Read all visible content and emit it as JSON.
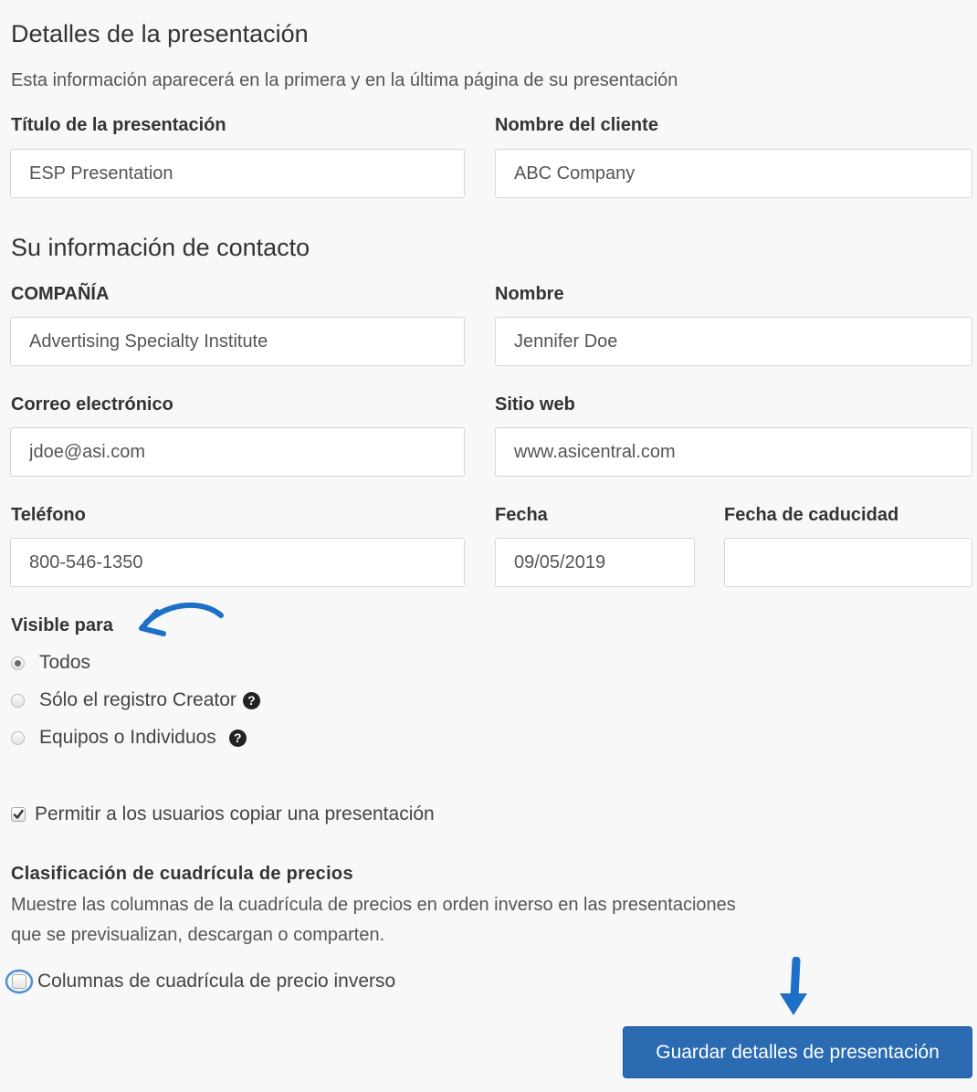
{
  "presentation": {
    "heading": "Detalles de la presentación",
    "description": "Esta información aparecerá en la primera y en la última página de su presentación",
    "title_label": "Título de la presentación",
    "title_value": "ESP Presentation",
    "client_label": "Nombre del cliente",
    "client_value": "ABC Company"
  },
  "contact": {
    "heading": "Su información de contacto",
    "company_label": "COMPAÑÍA",
    "company_value": "Advertising Specialty Institute",
    "name_label": "Nombre",
    "name_value": "Jennifer Doe",
    "email_label": "Correo electrónico",
    "email_value": "jdoe@asi.com",
    "website_label": "Sitio web",
    "website_value": "www.asicentral.com",
    "phone_label": "Teléfono",
    "phone_value": "800-546-1350",
    "date_label": "Fecha",
    "date_value": "09/05/2019",
    "expiry_label": "Fecha de caducidad",
    "expiry_value": ""
  },
  "visibility": {
    "label": "Visible para",
    "options": [
      {
        "label": "Todos",
        "selected": true
      },
      {
        "label": "Sólo el registro Creator",
        "selected": false
      },
      {
        "label": "Equipos o Individuos",
        "selected": false
      }
    ]
  },
  "copy_option": {
    "label": "Permitir a los usuarios copiar una presentación",
    "checked": true
  },
  "price_grid": {
    "heading": "Clasificación de cuadrícula de precios",
    "description_line1": "Muestre las columnas de la cuadrícula de precios en orden inverso en las presentaciones",
    "description_line2": "que se previsualizan, descargan o comparten.",
    "checkbox_label": "Columnas de cuadrícula de precio inverso",
    "checked": false
  },
  "save_button_label": "Guardar detalles de presentación",
  "colors": {
    "accent": "#2a6bb2",
    "annotation": "#1d6fc7",
    "background": "#f8f8f8"
  }
}
